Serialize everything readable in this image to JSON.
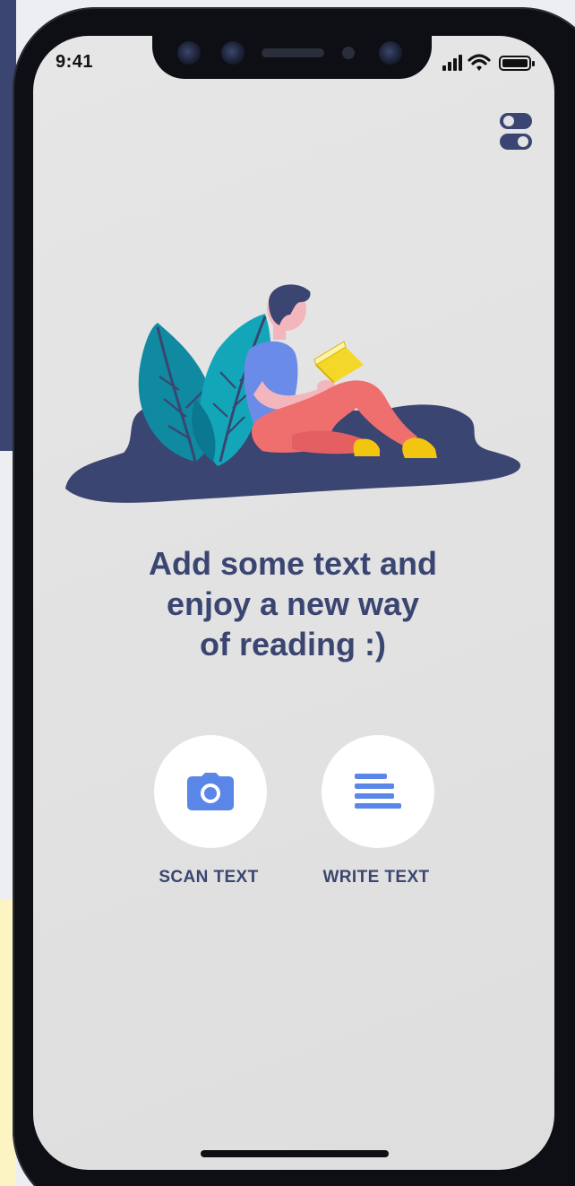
{
  "status_bar": {
    "time": "9:41",
    "icons": [
      "signal-icon",
      "wifi-icon",
      "battery-icon"
    ]
  },
  "settings": {
    "icon": "toggle-switches-icon"
  },
  "illustration": {
    "icon": "person-reading-illustration"
  },
  "headline": {
    "lines": [
      "Add some text and",
      "enjoy a new way",
      "of reading :)"
    ]
  },
  "actions": {
    "scan": {
      "label": "SCAN TEXT",
      "icon": "camera-icon"
    },
    "write": {
      "label": "WRITE TEXT",
      "icon": "text-lines-icon"
    }
  },
  "colors": {
    "navy": "#3b4571",
    "accent_blue": "#5a86e8",
    "teal": "#0f8aa0",
    "skin": "#f4b6bd",
    "shirt": "#6a8ce8",
    "pants": "#ef6f6f",
    "shoes": "#f2c511",
    "book": "#f3d82a",
    "screen_bg": "#e3e3e3"
  }
}
